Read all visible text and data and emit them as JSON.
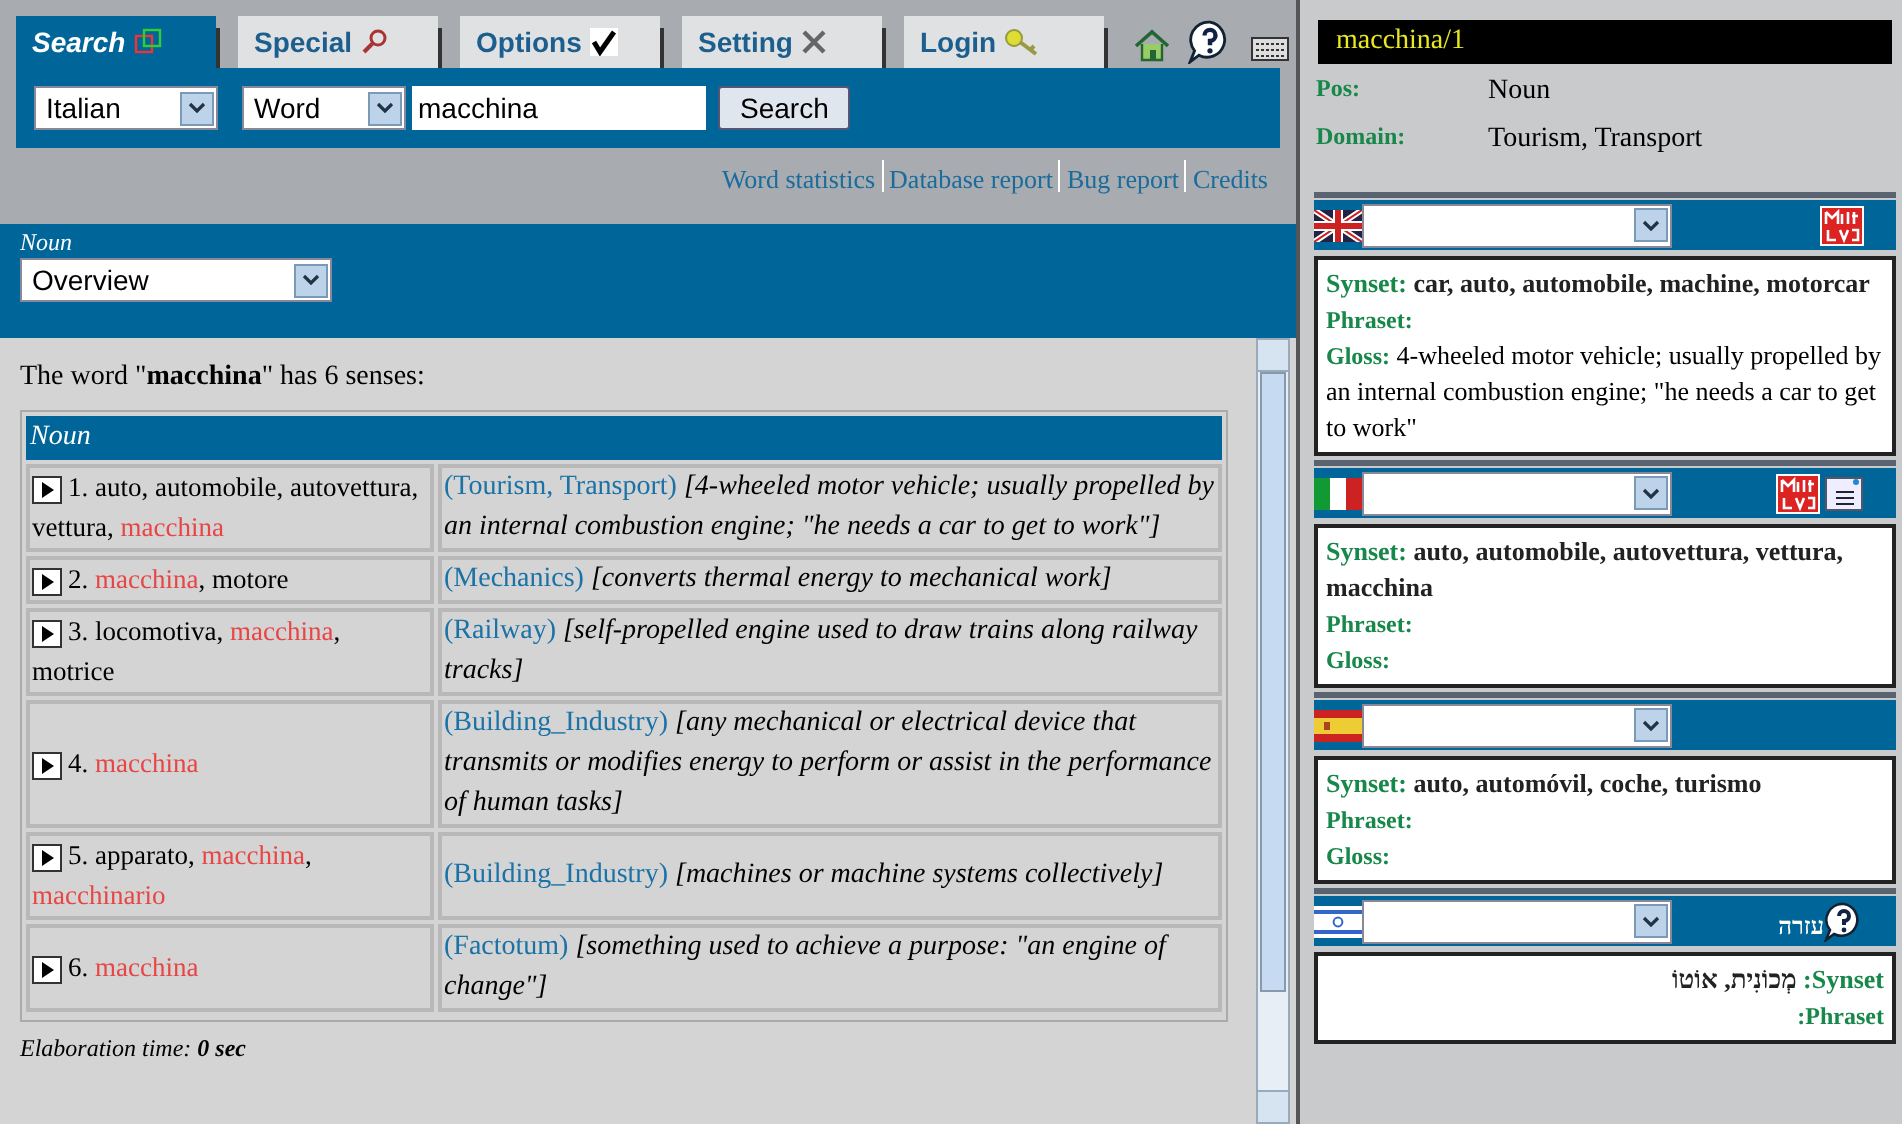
{
  "tabs": [
    {
      "label": "Search",
      "kind": "search",
      "selected": true
    },
    {
      "label": "Special",
      "kind": "special",
      "selected": false
    },
    {
      "label": "Options",
      "kind": "options",
      "selected": false
    },
    {
      "label": "Setting",
      "kind": "setting",
      "selected": false
    },
    {
      "label": "Login",
      "kind": "login",
      "selected": false
    }
  ],
  "search": {
    "language": "Italian",
    "mode": "Word",
    "query": "macchina",
    "button": "Search"
  },
  "links": [
    "Word statistics",
    "Database report",
    "Bug report",
    "Credits"
  ],
  "pos_filter": {
    "label": "Noun",
    "value": "Overview"
  },
  "summary": "The word \"**macchina**\" has 6 senses:",
  "table": {
    "heading": "Noun",
    "separator": ",",
    "rows": [
      {
        "number": "1.",
        "words": [
          {
            "text": "auto",
            "highlight": false
          },
          {
            "text": "automobile",
            "highlight": false
          },
          {
            "text": "autovettura",
            "highlight": false
          },
          {
            "text": "vettura",
            "highlight": false
          },
          {
            "text": "macchina",
            "highlight": true
          }
        ],
        "domain": "(Tourism, Transport)",
        "gloss": "[4-wheeled motor vehicle; usually propelled by an internal combustion engine; \"he needs a car to get to work\"]"
      },
      {
        "number": "2.",
        "words": [
          {
            "text": "macchina",
            "highlight": true
          },
          {
            "text": "motore",
            "highlight": false
          }
        ],
        "domain": "(Mechanics)",
        "gloss": "[converts thermal energy to mechanical work]"
      },
      {
        "number": "3.",
        "words": [
          {
            "text": "locomotiva",
            "highlight": false
          },
          {
            "text": "macchina",
            "highlight": true
          },
          {
            "text": "motrice",
            "highlight": false
          }
        ],
        "domain": "(Railway)",
        "gloss": "[self-propelled engine used to draw trains along railway tracks]"
      },
      {
        "number": "4.",
        "words": [
          {
            "text": "macchina",
            "highlight": true
          }
        ],
        "domain": "(Building_Industry)",
        "gloss": "[any mechanical or electrical device that transmits or modifies energy to perform or assist in the performance of human tasks]"
      },
      {
        "number": "5.",
        "words": [
          {
            "text": "apparato",
            "highlight": false
          },
          {
            "text": "macchina",
            "highlight": true
          },
          {
            "text": "macchinario",
            "highlight": true
          }
        ],
        "domain": "(Building_Industry)",
        "gloss": "[machines or machine systems collectively]"
      },
      {
        "number": "6.",
        "words": [
          {
            "text": "macchina",
            "highlight": true
          }
        ],
        "domain": "(Factotum)",
        "gloss": "[something used to achieve a purpose: \"an engine of change\"]"
      }
    ]
  },
  "elaboration": "Elaboration time: **0 sec**",
  "detail": {
    "title": "macchina/1",
    "fields": [
      {
        "label": "Pos:",
        "value": "Noun"
      },
      {
        "label": "Domain:",
        "value": "Tourism, Transport"
      }
    ]
  },
  "languages": [
    {
      "kind": "english",
      "logo": true,
      "notes": false,
      "synset_label": "Synset:",
      "synset": "car, auto, automobile, machine, motorcar",
      "phraset_label": "Phraset:",
      "gloss_label": "Gloss:",
      "gloss": "4-wheeled motor vehicle; usually propelled by an internal combustion engine; \"he needs a car to get to work\""
    },
    {
      "kind": "italian",
      "logo": true,
      "notes": true,
      "synset_label": "Synset:",
      "synset": "auto, automobile, autovettura, vettura, macchina",
      "phraset_label": "Phraset:",
      "gloss_label": "Gloss:"
    },
    {
      "kind": "spanish",
      "logo": false,
      "notes": false,
      "synset_label": "Synset:",
      "synset": "auto, automóvil, coche, turismo",
      "phraset_label": "Phraset:",
      "gloss_label": "Gloss:"
    },
    {
      "kind": "hebrew",
      "logo": false,
      "notes": false,
      "help_label": "עזרה",
      "synset_label": "Synset:",
      "synset": "מְכוֹנִית, אוֹטוֹ",
      "phraset_label": "Phraset:"
    }
  ]
}
